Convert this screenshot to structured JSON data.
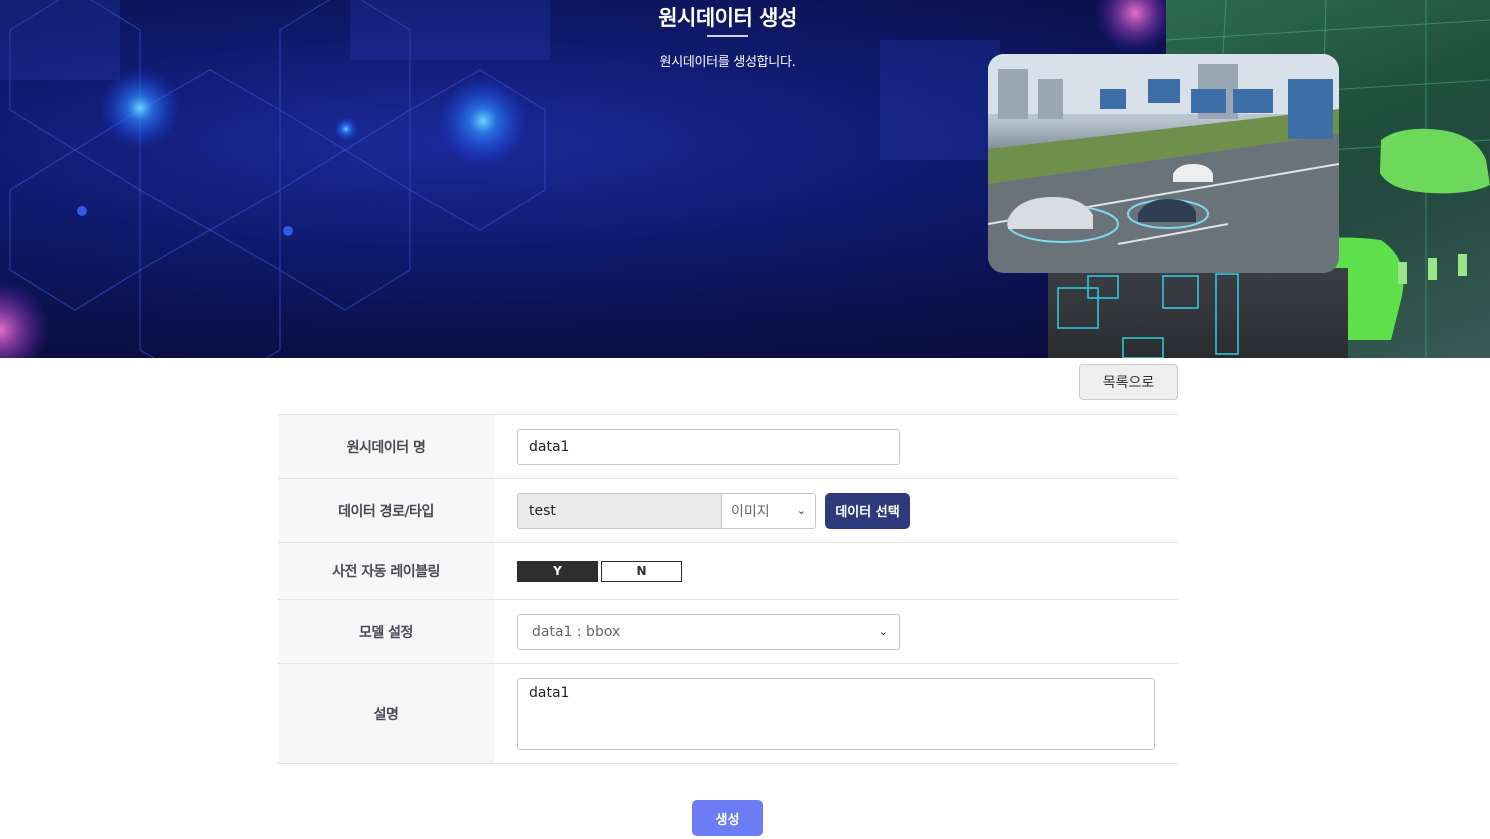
{
  "hero": {
    "title": "원시데이터 생성",
    "subtitle": "원시데이터를 생성합니다."
  },
  "actions": {
    "list_label": "목록으로",
    "create_label": "생성"
  },
  "form": {
    "name": {
      "label": "원시데이터 명",
      "value": "data1"
    },
    "path": {
      "label": "데이터 경로/타입",
      "value": "test",
      "type_selected": "이미지",
      "select_button": "데이터 선택"
    },
    "auto_label": {
      "label": "사전 자동 레이블링",
      "yes": "Y",
      "no": "N",
      "selected": "Y"
    },
    "model": {
      "label": "모델 설정",
      "selected": "data1 : bbox"
    },
    "description": {
      "label": "설명",
      "value": "data1"
    }
  },
  "colors": {
    "hero_bg": "#0f1a6e",
    "label_bg": "#f7f7f7",
    "primary_button": "#2f3a7c",
    "create_button": "#6b7cf5",
    "toggle_on": "#2e2e2e"
  },
  "icons": {
    "select_chevron": "chevron-down-icon"
  }
}
